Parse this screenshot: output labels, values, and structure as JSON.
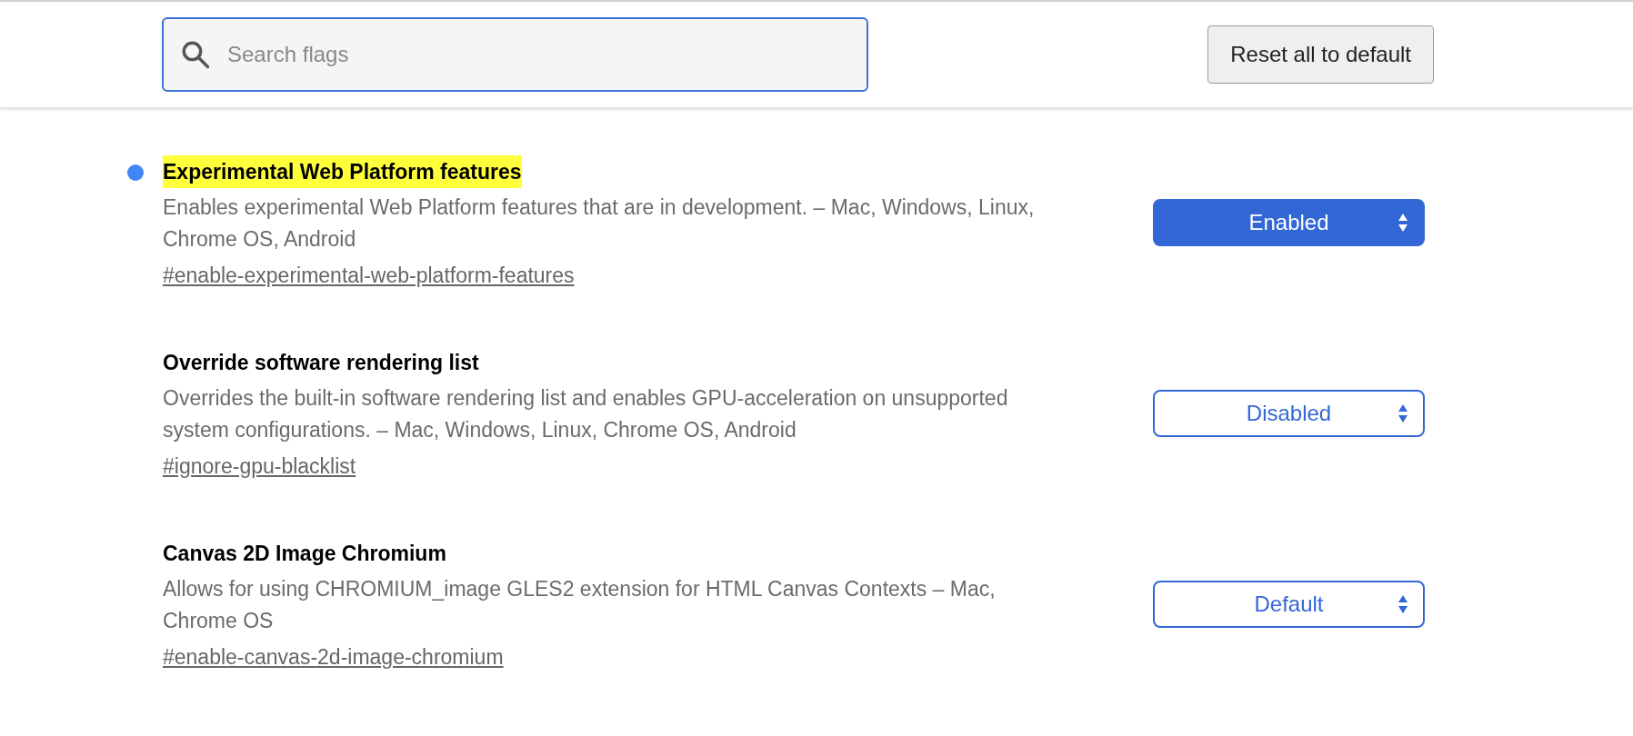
{
  "search": {
    "placeholder": "Search flags"
  },
  "reset_button": "Reset all to default",
  "flags": [
    {
      "title": "Experimental Web Platform features",
      "highlighted": true,
      "modified": true,
      "description": "Enables experimental Web Platform features that are in development. – Mac, Windows, Linux, Chrome OS, Android",
      "link": "#enable-experimental-web-platform-features",
      "value": "Enabled"
    },
    {
      "title": "Override software rendering list",
      "highlighted": false,
      "modified": false,
      "description": "Overrides the built-in software rendering list and enables GPU-acceleration on unsupported system configurations. – Mac, Windows, Linux, Chrome OS, Android",
      "link": "#ignore-gpu-blacklist",
      "value": "Disabled"
    },
    {
      "title": "Canvas 2D Image Chromium",
      "highlighted": false,
      "modified": false,
      "description": "Allows for using CHROMIUM_image GLES2 extension for HTML Canvas Contexts – Mac, Chrome OS",
      "link": "#enable-canvas-2d-image-chromium",
      "value": "Default"
    }
  ]
}
